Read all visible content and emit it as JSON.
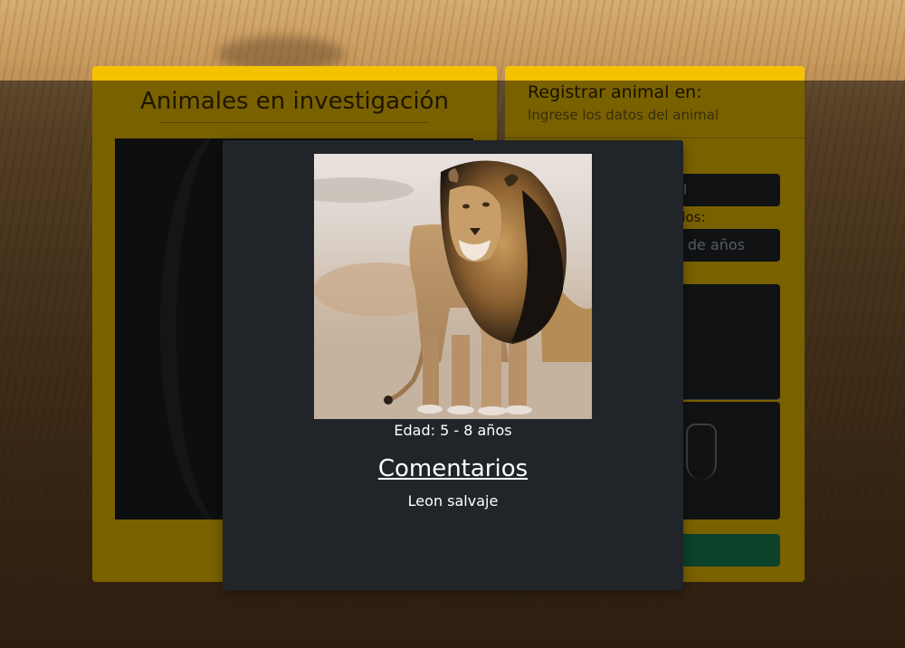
{
  "left_panel": {
    "title": "Animales en investigación"
  },
  "right_panel": {
    "title": "Registrar animal en:",
    "subtitle": "Ingrese los datos del animal",
    "name_field_fragment": "al",
    "age_label_fragment": "dos:",
    "age_field_fragment": "o de años"
  },
  "modal": {
    "image_alt": "León",
    "age_text": "Edad: 5 - 8 años",
    "comments_title": "Comentarios",
    "comments_body": "Leon salvaje"
  },
  "colors": {
    "card": "#f5c200",
    "modal": "#212529",
    "submit": "#198754"
  }
}
